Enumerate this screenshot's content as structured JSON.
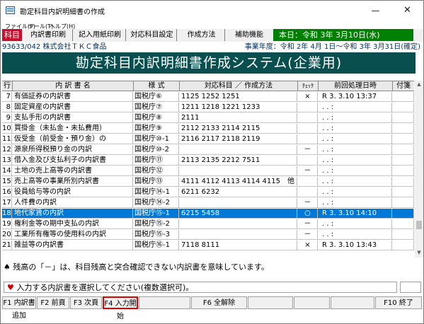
{
  "window": {
    "title": "勘定科目内訳明細書の作成",
    "min_glyph": "—",
    "max_glyph": "□",
    "close_glyph": "✕"
  },
  "menu": [
    "ファイル(F)",
    "ツール(T)",
    "ヘルプ(H)"
  ],
  "toolbar": {
    "active_tab": "科目",
    "buttons": [
      "内訳書印刷",
      "記入用紙印刷",
      "対応科目設定",
      "作成方法",
      "補助機能"
    ],
    "date": "本日：令和 3年 3月10日(水)"
  },
  "company": {
    "code_name": "93633/042 株式会社ＴＫＣ食品",
    "fiscal_year": "事業年度：令和 2年 4月 1日～令和 3年 3月31日(確定)"
  },
  "banner": "勘定科目内訳明細書作成システム(企業用)",
  "table": {
    "headers": [
      "行",
      "内 訳 書 名",
      "様 式",
      "対応科目 ／ 作成方法",
      "ﾁｪｯｸ",
      "前回処理日時",
      "付箋"
    ],
    "rows": [
      {
        "no": "7",
        "name": "有価証券の内訳書",
        "form": "国税庁⑥",
        "accounts": "1125 1252 1251",
        "check": "×",
        "date": "R 3. 3.10 13:37"
      },
      {
        "no": "8",
        "name": "固定資産の内訳書",
        "form": "国税庁⑦",
        "accounts": "1211 1218 1221 1233",
        "check": "",
        "date": ". .   :"
      },
      {
        "no": "9",
        "name": "支払手形の内訳書",
        "form": "国税庁⑧",
        "accounts": "2111",
        "check": "",
        "date": ". .   :"
      },
      {
        "no": "10",
        "name": "買掛金（未払金・未払費用）",
        "form": "国税庁⑨",
        "accounts": "2112 2133 2114 2115",
        "check": "",
        "date": ". .   :"
      },
      {
        "no": "11",
        "name": "仮受金（前受金・預り金）の",
        "form": "国税庁⑩-1",
        "accounts": "2116 2117 2118 2119",
        "check": "",
        "date": ". .   :"
      },
      {
        "no": "12",
        "name": "源泉所得税預り金の内訳",
        "form": "国税庁⑩-2",
        "accounts": "",
        "check": "－",
        "date": ". .   :"
      },
      {
        "no": "13",
        "name": "借入金及び支払利子の内訳書",
        "form": "国税庁⑪",
        "accounts": "2113 2135 2212 7511",
        "check": "",
        "date": ". .   :"
      },
      {
        "no": "14",
        "name": "土地の売上高等の内訳書",
        "form": "国税庁⑫",
        "accounts": "",
        "check": "－",
        "date": ". .   :"
      },
      {
        "no": "15",
        "name": "売上高等の事業所別内訳書",
        "form": "国税庁⑬",
        "accounts": "4111 4112 4113 4114 4115　他",
        "check": "",
        "date": ". .   :"
      },
      {
        "no": "16",
        "name": "役員給与等の内訳",
        "form": "国税庁⑭-1",
        "accounts": "6211 6232",
        "check": "",
        "date": ". .   :"
      },
      {
        "no": "17",
        "name": "人件費の内訳",
        "form": "国税庁⑭-2",
        "accounts": "",
        "check": "－",
        "date": ". .   :"
      },
      {
        "no": "18",
        "name": "地代家賃の内訳",
        "form": "国税庁⑮-1",
        "accounts": "6215 5458",
        "check": "○",
        "date": "R 3. 3.10 14:10",
        "selected": true
      },
      {
        "no": "19",
        "name": "権利金等の期中支払の内訳",
        "form": "国税庁⑮-2",
        "accounts": "",
        "check": "－",
        "date": ". .   :"
      },
      {
        "no": "20",
        "name": "工業所有権等の使用料の内訳",
        "form": "国税庁⑮-3",
        "accounts": "",
        "check": "－",
        "date": ". .   :"
      },
      {
        "no": "21",
        "name": "雑益等の内訳書",
        "form": "国税庁⑯-1",
        "accounts": "7118 8111",
        "check": "×",
        "date": "R 3. 3.10 13:43"
      }
    ]
  },
  "notes": {
    "balance_note": "♠ 残高の「－」は、科目残高と突合確認できない内訳書を意味しています。",
    "prompt_mark": "♥",
    "prompt": "入力する内訳書を選択してください(複数選択可)。"
  },
  "fkeys": [
    {
      "label": "F1 内訳書追加"
    },
    {
      "label": "F2 前頁"
    },
    {
      "label": "F3 次頁"
    },
    {
      "label": "F4 入力開始",
      "highlight": true
    },
    {
      "label": ""
    },
    {
      "label": "F6 全解除"
    },
    {
      "label": ""
    },
    {
      "label": ""
    },
    {
      "label": ""
    },
    {
      "label": "F10 終了"
    }
  ]
}
